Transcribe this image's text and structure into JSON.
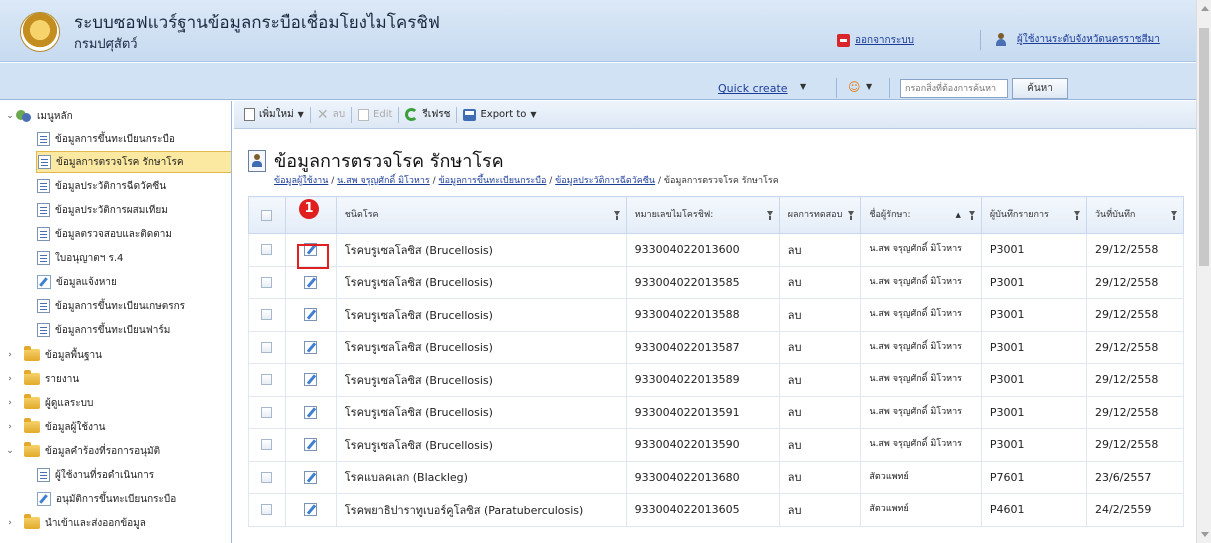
{
  "header": {
    "app_title": "ระบบซอฟแวร์ฐานข้อมูลกระบือเชื่อมโยงไมโครชิฟ",
    "app_subtitle": "กรมปศุสัตว์",
    "logout_label": "ออกจากระบบ",
    "user_label": "ผู้ใช้งานระดับจังหวัดนครราชสีมา"
  },
  "bar2": {
    "quick_create_label": "Quick create",
    "search_placeholder": "กรอกสิ่งที่ต้องการค้นหา",
    "search_button": "ค้นหา"
  },
  "sidebar": {
    "root_label": "เมนูหลัก",
    "items": [
      "ข้อมูลการขึ้นทะเบียนกระบือ",
      "ข้อมูลการตรวจโรค รักษาโรค",
      "ข้อมูลประวัติการฉีดวัคซีน",
      "ข้อมูลประวัติการผสมเทียม",
      "ข้อมูลตรวจสอบและติดตาม",
      "ใบอนุญาตฯ ร.4",
      "ข้อมูลแจ้งหาย",
      "ข้อมูลการขึ้นทะเบียนเกษตรกร",
      "ข้อมูลการขึ้นทะเบียนฟาร์ม"
    ],
    "folders": [
      "ข้อมูลพื้นฐาน",
      "รายงาน",
      "ผู้ดูแลระบบ",
      "ข้อมูลผู้ใช้งาน"
    ],
    "approval_folder": "ข้อมูลคำร้องที่รอการอนุมัติ",
    "approval_items": [
      "ผู้ใช้งานที่รอดำเนินการ",
      "อนุมัติการขึ้นทะเบียนกระบือ"
    ],
    "import_export_folder": "นำเข้าและส่งออกข้อมูล"
  },
  "toolbar": {
    "new_label": "เพิ่มใหม่",
    "delete_label": "ลบ",
    "edit_label": "Edit",
    "refresh_label": "รีเฟรช",
    "export_label": "Export to"
  },
  "page": {
    "title": "ข้อมูลการตรวจโรค รักษาโรค",
    "breadcrumb": [
      "ข้อมูลผู้ใช้งาน",
      "น.สพ จรุญศักดิ์ มิโวหาร",
      "ข้อมูลการขึ้นทะเบียนกระบือ",
      "ข้อมูลประวัติการฉีดวัคซีน"
    ],
    "breadcrumb_current": "ข้อมูลการตรวจโรค รักษาโรค",
    "marker_number": "1"
  },
  "table": {
    "headers": [
      "ชนิดโรค",
      "หมายเลขไมโครชิฟ:",
      "ผลการทดสอบ",
      "ชื่อผู้รักษา:",
      "ผู้บันทึกรายการ",
      "วันที่บันทึก"
    ],
    "rows": [
      [
        "โรคบรูเซลโลซิส (Brucellosis)",
        "933004022013600",
        "ลบ",
        "น.สพ จรุญศักดิ์ มิโวหาร",
        "P3001",
        "29/12/2558"
      ],
      [
        "โรคบรูเซลโลซิส (Brucellosis)",
        "933004022013585",
        "ลบ",
        "น.สพ จรุญศักดิ์ มิโวหาร",
        "P3001",
        "29/12/2558"
      ],
      [
        "โรคบรูเซลโลซิส (Brucellosis)",
        "933004022013588",
        "ลบ",
        "น.สพ จรุญศักดิ์ มิโวหาร",
        "P3001",
        "29/12/2558"
      ],
      [
        "โรคบรูเซลโลซิส (Brucellosis)",
        "933004022013587",
        "ลบ",
        "น.สพ จรุญศักดิ์ มิโวหาร",
        "P3001",
        "29/12/2558"
      ],
      [
        "โรคบรูเซลโลซิส (Brucellosis)",
        "933004022013589",
        "ลบ",
        "น.สพ จรุญศักดิ์ มิโวหาร",
        "P3001",
        "29/12/2558"
      ],
      [
        "โรคบรูเซลโลซิส (Brucellosis)",
        "933004022013591",
        "ลบ",
        "น.สพ จรุญศักดิ์ มิโวหาร",
        "P3001",
        "29/12/2558"
      ],
      [
        "โรคบรูเซลโลซิส (Brucellosis)",
        "933004022013590",
        "ลบ",
        "น.สพ จรุญศักดิ์ มิโวหาร",
        "P3001",
        "29/12/2558"
      ],
      [
        "โรคแบลคเลก (Blackleg)",
        "933004022013680",
        "ลบ",
        "สัตวแพทย์",
        "P7601",
        "23/6/2557"
      ],
      [
        "โรคพยาธิปาราทูเบอร์คูโลซิส (Paratuberculosis)",
        "933004022013605",
        "ลบ",
        "สัตวแพทย์",
        "P4601",
        "24/2/2559"
      ]
    ]
  }
}
